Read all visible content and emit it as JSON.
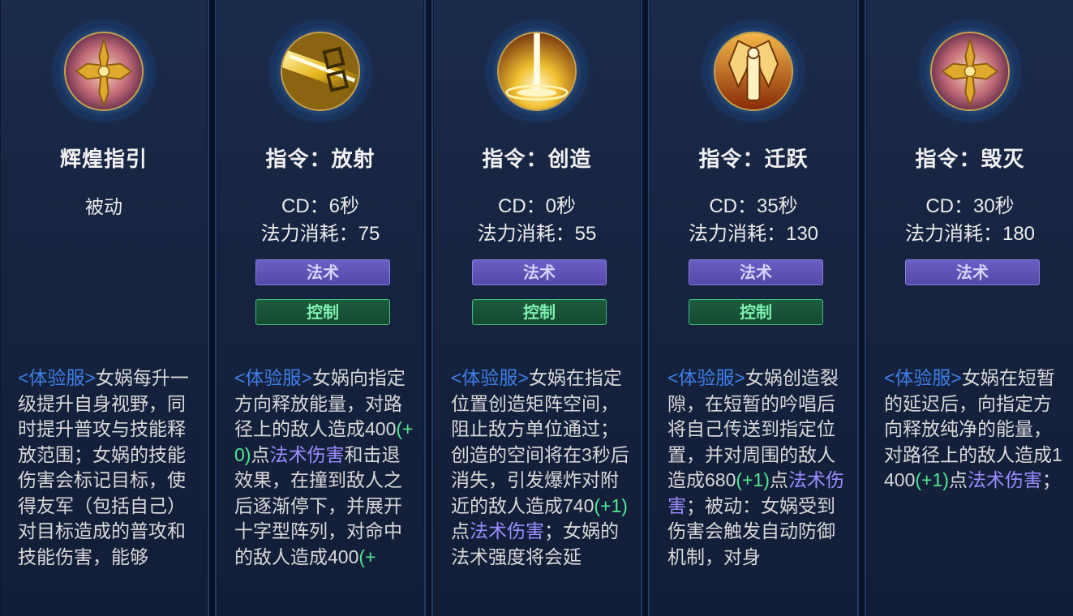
{
  "skills": [
    {
      "icon": "golden-cross-icon",
      "title": "辉煌指引",
      "type": "被动",
      "desc": [
        {
          "t": "<体验服>",
          "c": "tag"
        },
        {
          "t": "女娲每升一级提升自身视野，同时提升普攻与技能释放范围；女娲的技能伤害会标记目标，使得友军（包括自己）对目标造成的普攻和技能伤害，能够",
          "c": ""
        }
      ]
    },
    {
      "icon": "radiant-beam-icon",
      "title": "指令：放射",
      "cd": "CD：6秒",
      "mana": "法力消耗：75",
      "tags": [
        "法术",
        "控制"
      ],
      "desc": [
        {
          "t": "<体验服>",
          "c": "tag"
        },
        {
          "t": "女娲向指定方向释放能量，对路径上的敌人造成400",
          "c": ""
        },
        {
          "t": "(+0)",
          "c": "num"
        },
        {
          "t": "点",
          "c": ""
        },
        {
          "t": "法术伤害",
          "c": "mag"
        },
        {
          "t": "和击退效果，在撞到敌人之后逐渐停下，并展开十字型阵列，对命中的敌人造成400",
          "c": ""
        },
        {
          "t": "(+",
          "c": "num"
        }
      ]
    },
    {
      "icon": "light-pillar-icon",
      "title": "指令：创造",
      "cd": "CD：0秒",
      "mana": "法力消耗：55",
      "tags": [
        "法术",
        "控制"
      ],
      "desc": [
        {
          "t": "<体验服>",
          "c": "tag"
        },
        {
          "t": "女娲在指定位置创造矩阵空间，阻止敌方单位通过；创造的空间将在3秒后消失，引发爆炸对附近的敌人造成740",
          "c": ""
        },
        {
          "t": "(+1)",
          "c": "num"
        },
        {
          "t": "点",
          "c": ""
        },
        {
          "t": "法术伤害",
          "c": "mag"
        },
        {
          "t": "；女娲的法术强度将会延",
          "c": ""
        }
      ]
    },
    {
      "icon": "winged-goddess-icon",
      "title": "指令：迁跃",
      "cd": "CD：35秒",
      "mana": "法力消耗：130",
      "tags": [
        "法术",
        "控制"
      ],
      "desc": [
        {
          "t": "<体验服>",
          "c": "tag"
        },
        {
          "t": "女娲创造裂隙，在短暂的吟唱后将自己传送到指定位置，并对周围的敌人造成680",
          "c": ""
        },
        {
          "t": "(+1)",
          "c": "num"
        },
        {
          "t": "点",
          "c": ""
        },
        {
          "t": "法术伤害",
          "c": "mag"
        },
        {
          "t": "；被动：女娲受到伤害会触发自动防御机制，对身",
          "c": ""
        }
      ]
    },
    {
      "icon": "golden-cross-icon",
      "title": "指令：毁灭",
      "cd": "CD：30秒",
      "mana": "法力消耗：180",
      "tags": [
        "法术"
      ],
      "desc": [
        {
          "t": "<体验服>",
          "c": "tag"
        },
        {
          "t": "女娲在短暂的延迟后，向指定方向释放纯净的能量，对路径上的敌人造成1400",
          "c": ""
        },
        {
          "t": "(+1)",
          "c": "num"
        },
        {
          "t": "点",
          "c": ""
        },
        {
          "t": "法术伤害",
          "c": "mag"
        },
        {
          "t": "；",
          "c": ""
        }
      ]
    }
  ]
}
